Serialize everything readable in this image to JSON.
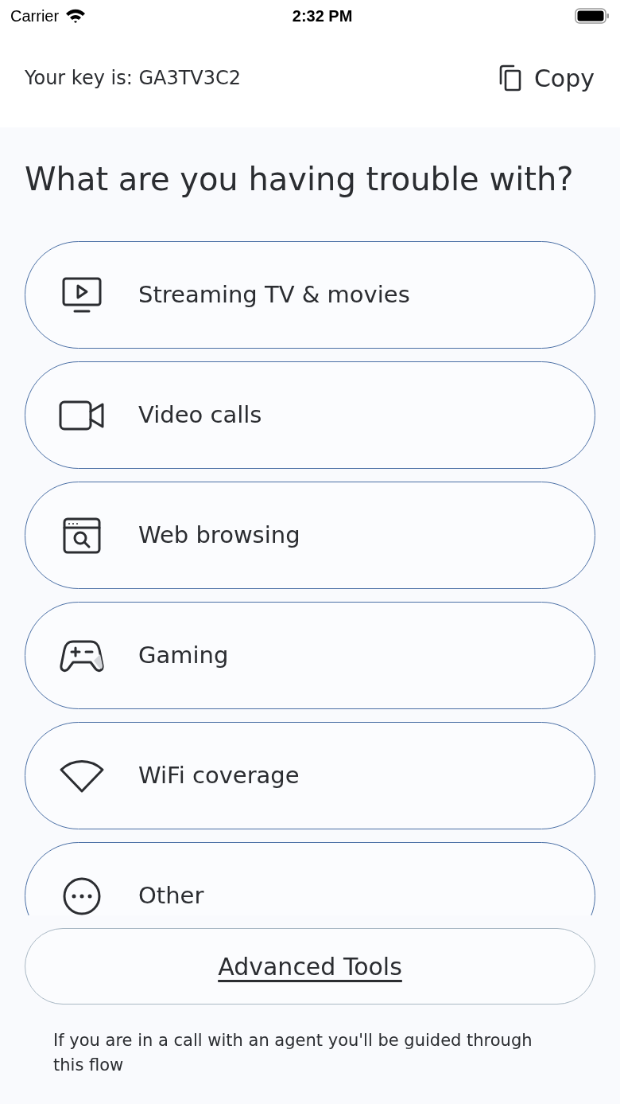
{
  "status_bar": {
    "carrier": "Carrier",
    "time": "2:32 PM"
  },
  "header": {
    "key_label": "Your key is: GA3TV3C2",
    "copy_label": "Copy"
  },
  "title": "What are you having trouble with?",
  "options": [
    {
      "kind": "tv",
      "label": "Streaming TV & movies"
    },
    {
      "kind": "video",
      "label": "Video calls"
    },
    {
      "kind": "browser",
      "label": "Web browsing"
    },
    {
      "kind": "gamepad",
      "label": "Gaming"
    },
    {
      "kind": "wifi",
      "label": "WiFi coverage"
    },
    {
      "kind": "other",
      "label": "Other"
    }
  ],
  "advanced_button": "Advanced Tools",
  "footer": "If you are in a call with an agent you'll be guided through this flow"
}
